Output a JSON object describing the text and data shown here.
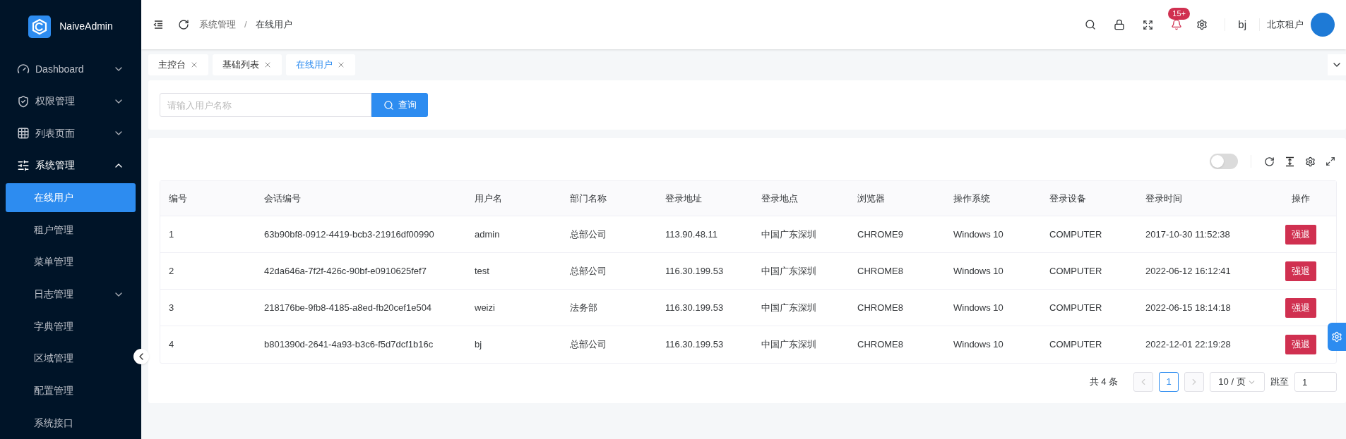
{
  "sidebar": {
    "logo": "NaiveAdmin",
    "items": [
      {
        "label": "Dashboard",
        "expandable": true,
        "expanded": false
      },
      {
        "label": "权限管理",
        "expandable": true,
        "expanded": false
      },
      {
        "label": "列表页面",
        "expandable": true,
        "expanded": false
      },
      {
        "label": "系统管理",
        "expandable": true,
        "expanded": true,
        "children": [
          {
            "label": "在线用户",
            "selected": true,
            "expandable": false
          },
          {
            "label": "租户管理",
            "selected": false,
            "expandable": false
          },
          {
            "label": "菜单管理",
            "selected": false,
            "expandable": false
          },
          {
            "label": "日志管理",
            "selected": false,
            "expandable": true,
            "expanded": false
          },
          {
            "label": "字典管理",
            "selected": false,
            "expandable": false
          },
          {
            "label": "区域管理",
            "selected": false,
            "expandable": false
          },
          {
            "label": "配置管理",
            "selected": false,
            "expandable": false
          },
          {
            "label": "系统接口",
            "selected": false,
            "expandable": false
          }
        ]
      }
    ]
  },
  "header": {
    "breadcrumb": [
      "系统管理",
      "在线用户"
    ],
    "separator": "/",
    "notification_count": "15+",
    "user": "bj",
    "tenant": "北京租户"
  },
  "tabs": [
    {
      "label": "主控台",
      "selected": false
    },
    {
      "label": "基础列表",
      "selected": false
    },
    {
      "label": "在线用户",
      "selected": true
    }
  ],
  "search": {
    "placeholder": "请输入用户名称",
    "button": "查询"
  },
  "toolbar": {
    "toggle_on": false
  },
  "table": {
    "columns": [
      "编号",
      "会话编号",
      "用户名",
      "部门名称",
      "登录地址",
      "登录地点",
      "浏览器",
      "操作系统",
      "登录设备",
      "登录时间",
      "操作"
    ],
    "rows": [
      [
        "1",
        "63b90bf8-0912-4419-bcb3-21916df00990",
        "admin",
        "总部公司",
        "113.90.48.11",
        "中国广东深圳",
        "CHROME9",
        "Windows 10",
        "COMPUTER",
        "2017-10-30 11:52:38",
        "强退"
      ],
      [
        "2",
        "42da646a-7f2f-426c-90bf-e0910625fef7",
        "test",
        "总部公司",
        "116.30.199.53",
        "中国广东深圳",
        "CHROME8",
        "Windows 10",
        "COMPUTER",
        "2022-06-12 16:12:41",
        "强退"
      ],
      [
        "3",
        "218176be-9fb8-4185-a8ed-fb20cef1e504",
        "weizi",
        "法务部",
        "116.30.199.53",
        "中国广东深圳",
        "CHROME8",
        "Windows 10",
        "COMPUTER",
        "2022-06-15 18:14:18",
        "强退"
      ],
      [
        "4",
        "b801390d-2641-4a93-b3c6-f5d7dcf1b16c",
        "bj",
        "总部公司",
        "116.30.199.53",
        "中国广东深圳",
        "CHROME8",
        "Windows 10",
        "COMPUTER",
        "2022-12-01 22:19:28",
        "强退"
      ]
    ]
  },
  "pagination": {
    "total": "共 4 条",
    "pages": [
      {
        "label": "1",
        "selected": true
      }
    ],
    "page_size": "10 / 页",
    "jump_label": "跳至",
    "jump_value": "1"
  }
}
